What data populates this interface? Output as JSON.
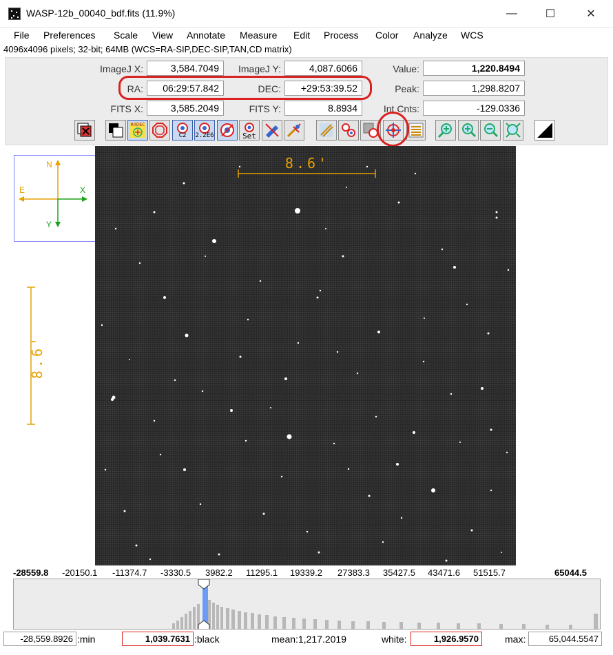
{
  "window": {
    "title": "WASP-12b_00040_bdf.fits (11.9%)",
    "minimize_glyph": "—",
    "maximize_glyph": "☐",
    "close_glyph": "✕"
  },
  "menu": [
    "File",
    "Preferences",
    "Scale",
    "View",
    "Annotate",
    "Measure",
    "Edit",
    "Process",
    "Color",
    "Analyze",
    "WCS"
  ],
  "image_info": "4096x4096 pixels; 32-bit; 64MB (WCS=RA-SIP,DEC-SIP,TAN,CD matrix)",
  "coords": {
    "imagej_x_label": "ImageJ X:",
    "imagej_x": "3,584.7049",
    "imagej_y_label": "ImageJ Y:",
    "imagej_y": "4,087.6066",
    "value_label": "Value:",
    "value": "1,220.8494",
    "ra_label": "RA:",
    "ra": "06:29:57.842",
    "dec_label": "DEC:",
    "dec": "+29:53:39.52",
    "peak_label": "Peak:",
    "peak": "1,298.8207",
    "fits_x_label": "FITS X:",
    "fits_x": "3,585.2049",
    "fits_y_label": "FITS Y:",
    "fits_y": "8.8934",
    "int_cnts_label": "Int Cnts:",
    "int_cnts": "-129.0336"
  },
  "toolbar": {
    "c2_label": "C2",
    "c226_label": "2.2E6",
    "set_label": "Set",
    "radec_label": "RADEC"
  },
  "compass": {
    "n_label": "N",
    "e_label": "E",
    "x_label": "X",
    "y_label": "Y",
    "wcs_color": "#e8a000",
    "pixel_color": "#1aa31a"
  },
  "scalebar": {
    "label": "8.6'",
    "color": "#e8a000"
  },
  "histogram_ticks": {
    "min": "-28559.8",
    "labels": [
      "-20150.1",
      "-11374.7",
      "-3330.5",
      "3982.2",
      "11295.1",
      "19339.2",
      "27383.3",
      "35427.5",
      "43471.6",
      "51515.7"
    ],
    "max": "65044.5"
  },
  "bottom": {
    "min_value": "-28,559.8926",
    "min_label": ":min",
    "black_value": "1,039.7631",
    "black_label": ":black",
    "mean_text": "mean:1,217.2019",
    "white_label": "white:",
    "white_value": "1,926.9570",
    "max_label": "max:",
    "max_value": "65,044.5547"
  },
  "highlight_color": "#d9211f"
}
